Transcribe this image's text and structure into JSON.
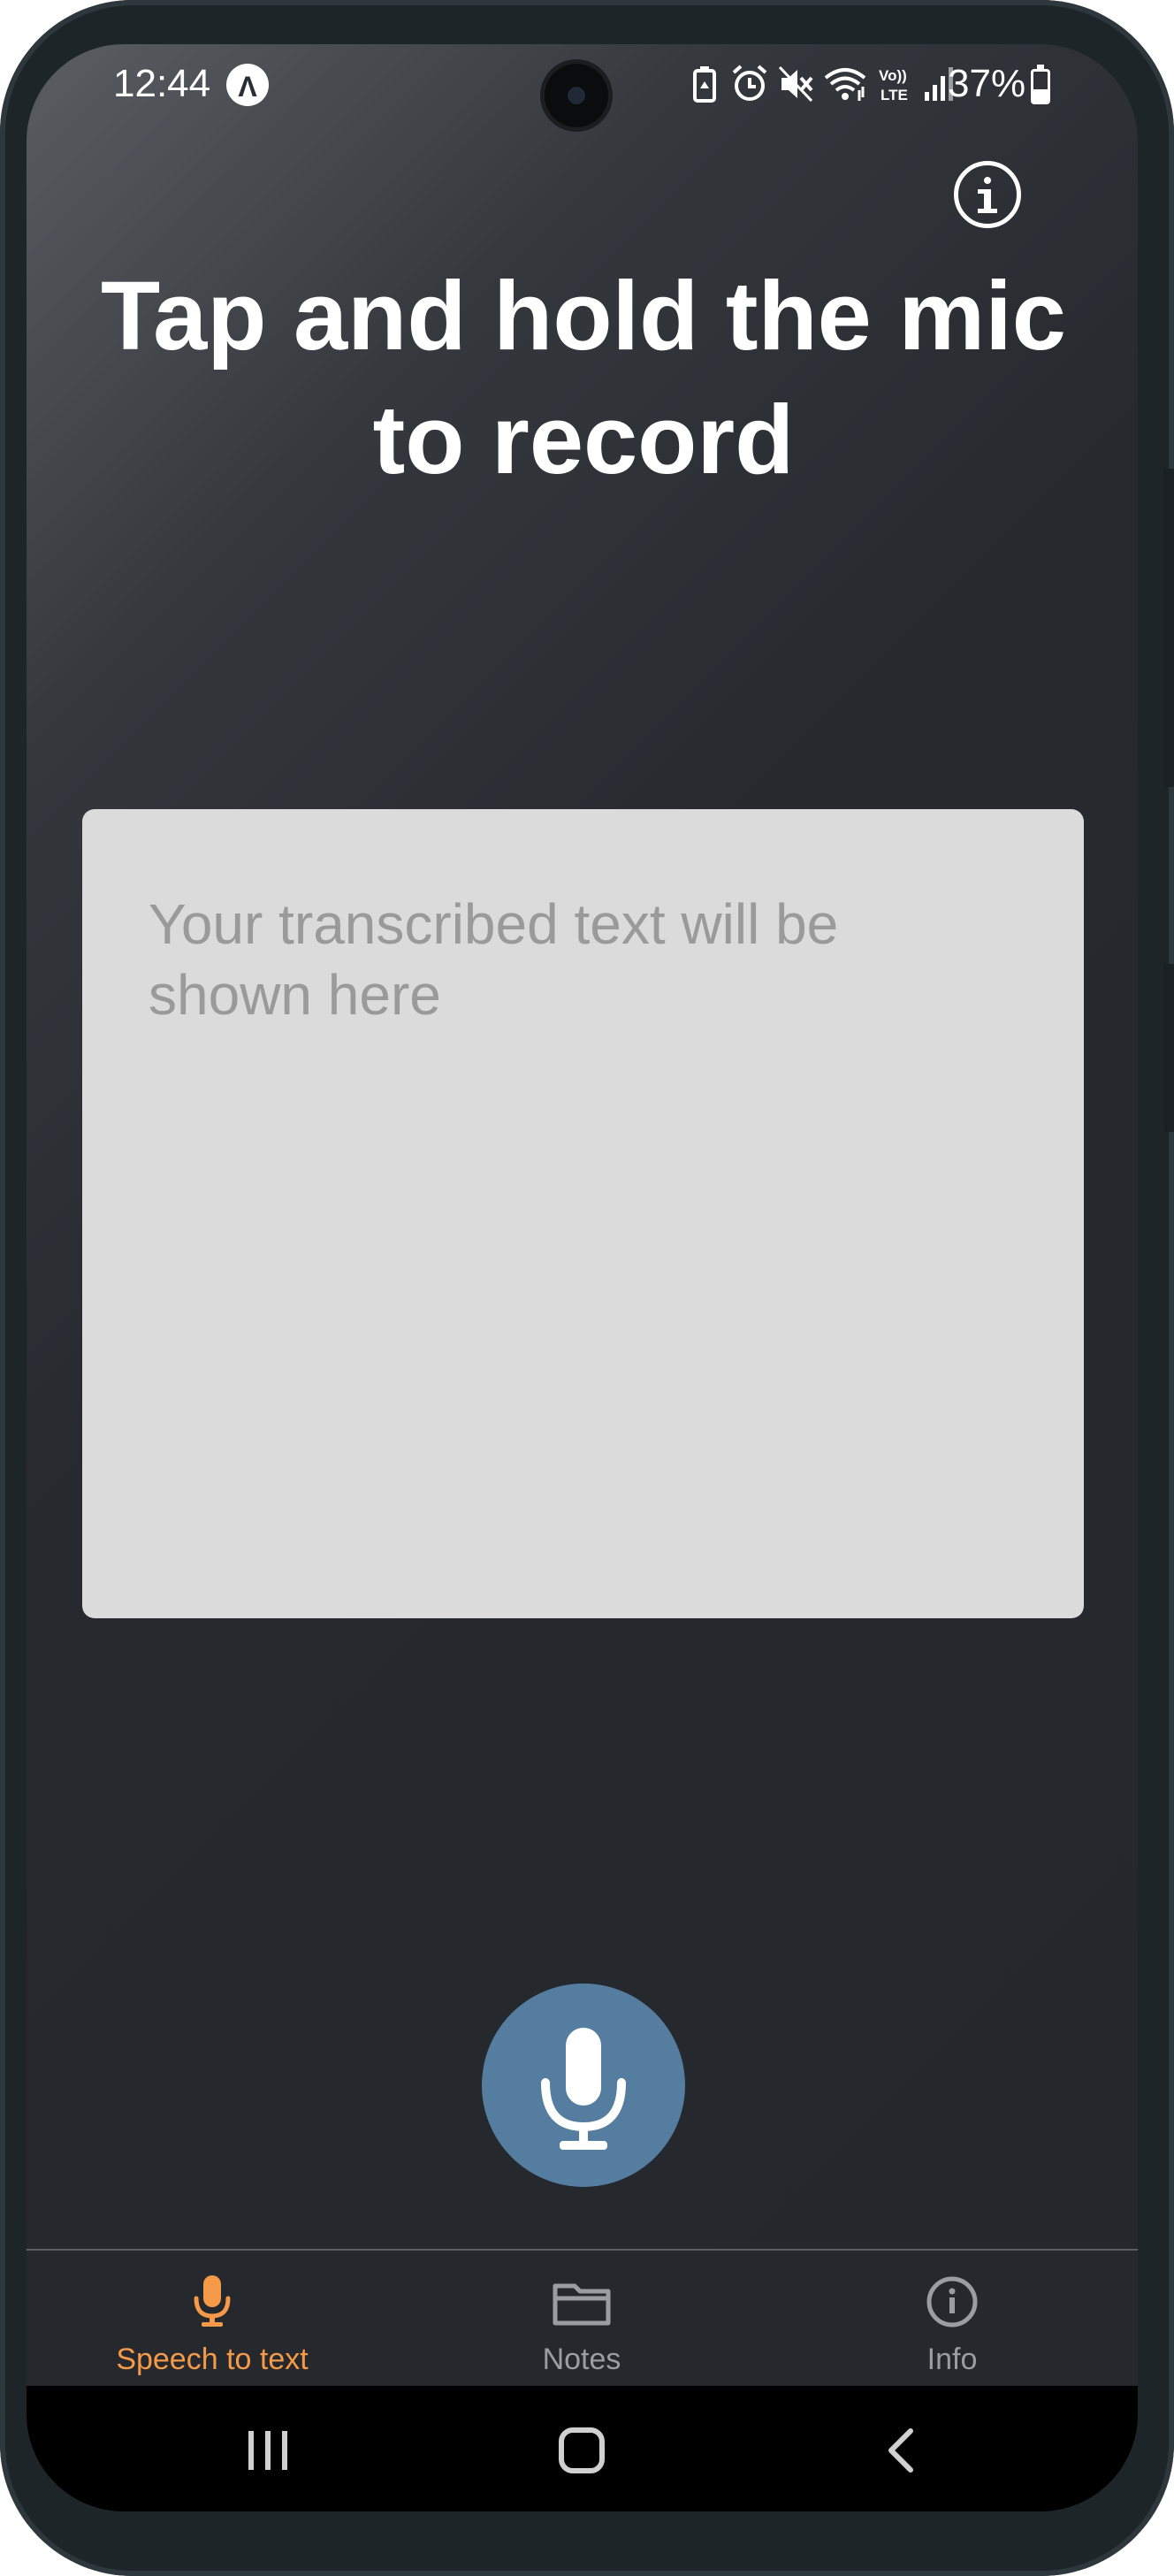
{
  "status_bar": {
    "time": "12:44",
    "app_indicator_glyph": "Λ",
    "battery": "37%",
    "icons": [
      "battery-saver-icon",
      "alarm-icon",
      "mute-icon",
      "wifi-icon",
      "volte-icon",
      "signal-icon"
    ]
  },
  "header": {
    "info_button": "info-icon",
    "title": "Tap and hold the mic to record"
  },
  "transcript": {
    "placeholder": "Your transcribed text will be shown here"
  },
  "record_button": {
    "icon": "microphone-icon",
    "color": "#547da0"
  },
  "bottom_nav": {
    "items": [
      {
        "label": "Speech to text",
        "icon": "microphone-icon",
        "active": true
      },
      {
        "label": "Notes",
        "icon": "folder-icon",
        "active": false
      },
      {
        "label": "Info",
        "icon": "info-icon",
        "active": false
      }
    ],
    "active_color": "#f59a48",
    "inactive_color": "#9a9ea3"
  },
  "system_nav": [
    "recents-icon",
    "home-icon",
    "back-icon"
  ]
}
